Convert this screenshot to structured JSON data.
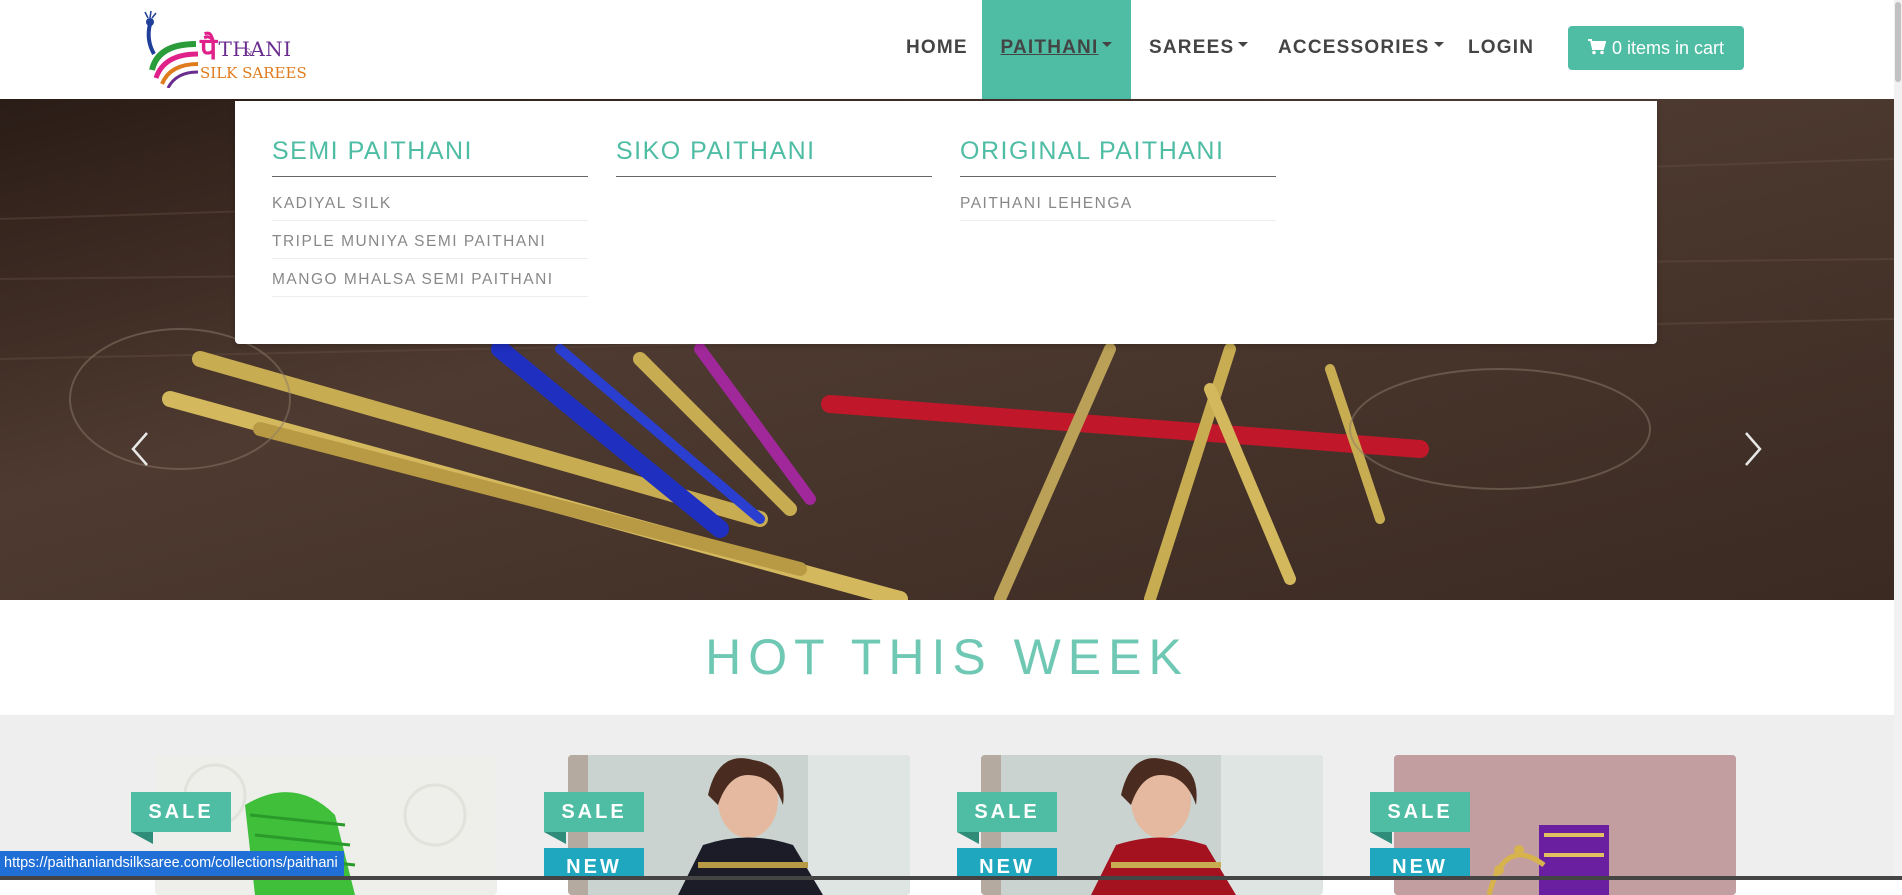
{
  "logo": {
    "devanagari": "पै",
    "main": "THANI",
    "amp": "&",
    "sub": "SILK SAREES"
  },
  "nav": {
    "items": [
      {
        "label": "HOME"
      },
      {
        "label": "PAITHANI"
      },
      {
        "label": "SAREES"
      },
      {
        "label": "ACCESSORIES"
      },
      {
        "label": "LOGIN"
      }
    ],
    "active": "PAITHANI",
    "cart_label": "0 items in cart"
  },
  "mega_menu": {
    "columns": [
      {
        "heading": "SEMI PAITHANI",
        "links": [
          "KADIYAL SILK",
          "TRIPLE MUNIYA SEMI PAITHANI",
          "MANGO MHALSA SEMI PAITHANI"
        ]
      },
      {
        "heading": "SIKO PAITHANI",
        "links": []
      },
      {
        "heading": "ORIGINAL PAITHANI",
        "links": [
          "PAITHANI LEHENGA"
        ]
      }
    ]
  },
  "hero": {
    "prev_icon": "chevron-left-icon",
    "next_icon": "chevron-right-icon"
  },
  "section": {
    "title": "HOT THIS WEEK"
  },
  "products": [
    {
      "sale": "SALE",
      "new": ""
    },
    {
      "sale": "SALE",
      "new": "NEW"
    },
    {
      "sale": "SALE",
      "new": "NEW"
    },
    {
      "sale": "SALE",
      "new": "NEW"
    }
  ],
  "status_bar": {
    "url": "https://paithaniandsilksaree.com/collections/paithani"
  },
  "colors": {
    "accent": "#4fbda4",
    "new_badge": "#1fa7bf",
    "status_bar": "#1f6fd6"
  }
}
